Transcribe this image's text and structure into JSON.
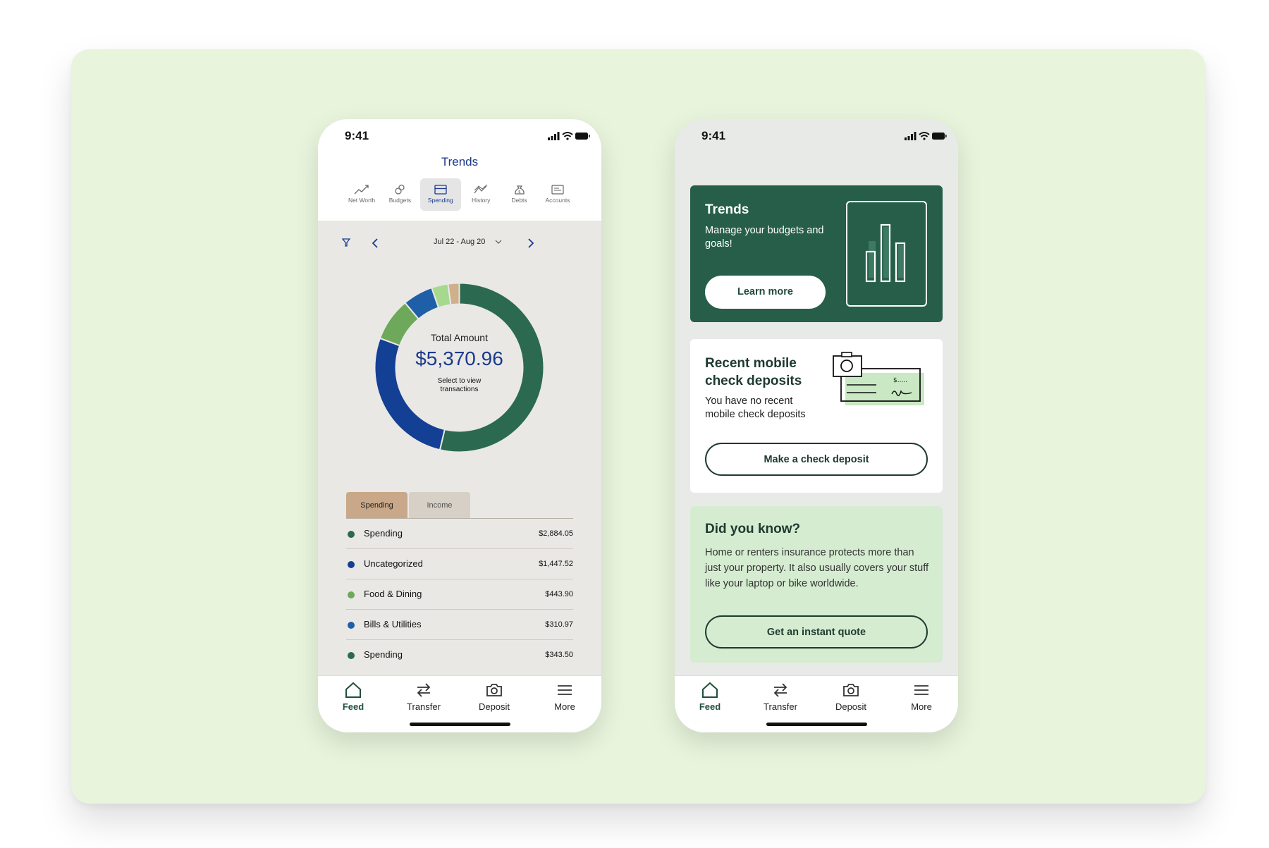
{
  "colors": {
    "background": "#e8f4dc",
    "accent_green": "#265e4a",
    "accent_blue": "#1b3a8c",
    "light_green_card": "#d5ecd1"
  },
  "phone_trends": {
    "status_time": "9:41",
    "title": "Trends",
    "tabs": [
      {
        "label": "Net Worth",
        "icon": "line-trend-icon"
      },
      {
        "label": "Budgets",
        "icon": "budgets-icon"
      },
      {
        "label": "Spending",
        "icon": "card-icon",
        "active": true
      },
      {
        "label": "History",
        "icon": "history-chart-icon"
      },
      {
        "label": "Debts",
        "icon": "money-bag-icon"
      },
      {
        "label": "Accounts",
        "icon": "accounts-icon"
      }
    ],
    "date_range": "Jul 22 - Aug 20",
    "donut": {
      "label": "Total Amount",
      "amount": "$5,370.96",
      "hint": "Select to view transactions"
    },
    "segment_tabs": {
      "spending": "Spending",
      "income": "Income",
      "selected": "Spending"
    },
    "legend": [
      {
        "name": "Spending",
        "value": "$2,884.05",
        "color": "#2b6a50"
      },
      {
        "name": "Uncategorized",
        "value": "$1,447.52",
        "color": "#133f94"
      },
      {
        "name": "Food & Dining",
        "value": "$443.90",
        "color": "#6ea85a"
      },
      {
        "name": "Bills & Utilities",
        "value": "$310.97",
        "color": "#1f5fa8"
      },
      {
        "name": "Spending",
        "value": "$343.50",
        "color": "#2b6a50"
      }
    ],
    "nav": [
      "Feed",
      "Transfer",
      "Deposit",
      "More"
    ]
  },
  "chart_data": {
    "type": "pie",
    "categories": [
      "Spending",
      "Uncategorized",
      "Food & Dining",
      "Bills & Utilities",
      "Light green",
      "Tan"
    ],
    "values": [
      2884.05,
      1447.52,
      443.9,
      310.97,
      170,
      115
    ],
    "colors": [
      "#2b6a50",
      "#133f94",
      "#6ea85a",
      "#1f5fa8",
      "#a6d88e",
      "#cfb08c"
    ]
  },
  "phone_home": {
    "status_time": "9:41",
    "trends_card": {
      "title": "Trends",
      "subtitle": "Manage your budgets and goals!",
      "button": "Learn more"
    },
    "check_card": {
      "title": "Recent mobile check deposits",
      "subtitle": "You have no recent mobile check deposits",
      "button": "Make a check deposit",
      "check_amount_text": "$....."
    },
    "know_card": {
      "title": "Did you know?",
      "body": "Home or renters insurance protects more than just your property. It also usually covers your stuff like your laptop or bike worldwide.",
      "button": "Get an instant quote"
    },
    "nav": [
      "Feed",
      "Transfer",
      "Deposit",
      "More"
    ]
  }
}
